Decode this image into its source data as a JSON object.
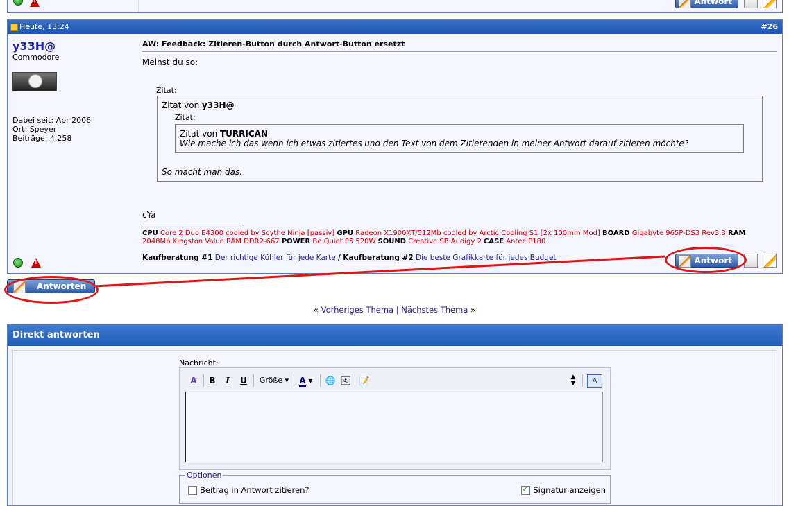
{
  "post": {
    "date": "Heute, 13:24",
    "number": "#26",
    "username": "y33H@",
    "usertitle": "Commodore",
    "joined": "Dabei seit: Apr 2006",
    "location": "Ort: Speyer",
    "posts": "Beiträge: 4.258",
    "title": "AW: Feedback: Zitieren-Button durch Antwort-Button ersetzt",
    "intro": "Meinst du so:",
    "quote_label": "Zitat:",
    "quote_prefix": "Zitat von ",
    "quote_author": "y33H@",
    "inner_quote_label": "Zitat:",
    "inner_quote_prefix": "Zitat von ",
    "inner_quote_author": "TURRICAN",
    "inner_quote_text": "Wie mache ich das wenn ich etwas zitiertes und den Text von dem Zitierenden in meiner Antwort darauf zitieren möchte?",
    "quote_text": "So macht man das.",
    "closing": "cYa",
    "signature": {
      "cpu_label": "CPU",
      "cpu": " Core 2 Duo E4300 cooled by Scythe Ninja [passiv] ",
      "gpu_label": "GPU",
      "gpu": " Radeon X1900XT/512Mb cooled by Arctic Cooling S1 [2x 100mm Mod] ",
      "board_label": "BOARD",
      "board": " Gigabyte 965P-DS3 Rev3.3 ",
      "ram_label": "RAM",
      "ram": " 2048Mb Kingston Value RAM DDR2-667 ",
      "power_label": "POWER",
      "power": " Be Quiet P5 520W ",
      "sound_label": "SOUND",
      "sound": " Creative SB Audigy 2 ",
      "case_label": "CASE",
      "case": " Antec P180",
      "link1_label": "Kaufberatung #1",
      "link1_text": " Der richtige Kühler für jede Karte ",
      "separator": "/",
      "link2_label": "Kaufberatung #2",
      "link2_text": " Die beste Grafikkarte für jedes Budget"
    },
    "reply_button": "Antwort"
  },
  "prev_post": {
    "reply_button": "Antwort"
  },
  "reply_thread_button": "Antworten",
  "thread_nav": {
    "prev_arrow": "«",
    "prev": "Vorheriges Thema",
    "sep": "|",
    "next": "Nächstes Thema",
    "next_arrow": "»"
  },
  "quick_reply": {
    "title": "Direkt antworten",
    "message_label": "Nachricht:",
    "toolbar": {
      "bold": "B",
      "italic": "I",
      "underline": "U",
      "size": "Größe",
      "font_color": "A"
    },
    "textarea_value": "",
    "options_legend": "Optionen",
    "quote_option": "Beitrag in Antwort zitieren?",
    "quote_checked": false,
    "signature_option": "Signatur anzeigen",
    "signature_checked": true
  },
  "colors": {
    "header_blue": "#1d57b5",
    "signature_red": "#cc0000",
    "link_blue": "#22229c",
    "annotation_red": "#e01515"
  }
}
